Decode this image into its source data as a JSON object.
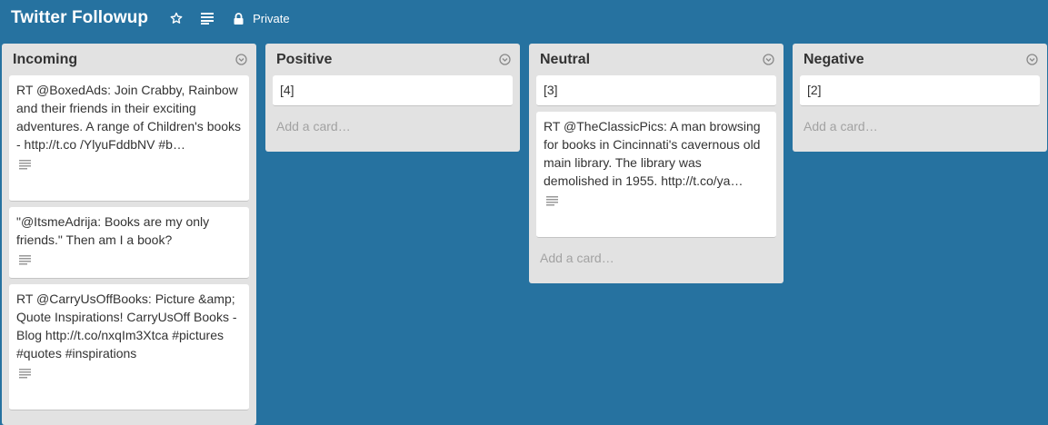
{
  "header": {
    "board_title": "Twitter Followup",
    "star_icon": "star-icon",
    "menu_icon": "menu-icon",
    "lock_icon": "lock-icon",
    "privacy_label": "Private"
  },
  "lists": [
    {
      "name": "Incoming",
      "cards": [
        {
          "text": "RT @BoxedAds: Join Crabby, Rainbow and their friends in their exciting adventures. A range of Children's books - http://t.co /YlyuFddbNV #b…",
          "has_description": true
        },
        {
          "text": "\"@ItsmeAdrija: Books are my only friends.\" Then am I a book?",
          "has_description": true
        },
        {
          "text": "RT @CarryUsOffBooks: Picture &amp; Quote Inspirations! CarryUsOff Books - Blog http://t.co/nxqIm3Xtca #pictures #quotes #inspirations",
          "has_description": true
        }
      ]
    },
    {
      "name": "Positive",
      "cards": [
        {
          "text": "[4]",
          "has_description": false
        }
      ],
      "add_card_label": "Add a card…"
    },
    {
      "name": "Neutral",
      "cards": [
        {
          "text": "[3]",
          "has_description": false
        },
        {
          "text": "RT @TheClassicPics: A man browsing for books in Cincinnati's cavernous old main library. The library was demolished in 1955. http://t.co/ya…",
          "has_description": true
        }
      ],
      "add_card_label": "Add a card…"
    },
    {
      "name": "Negative",
      "cards": [
        {
          "text": "[2]",
          "has_description": false
        }
      ],
      "add_card_label": "Add a card…"
    }
  ],
  "colors": {
    "board_background": "#2672a0",
    "list_background": "#e2e2e2",
    "card_background": "#ffffff"
  }
}
